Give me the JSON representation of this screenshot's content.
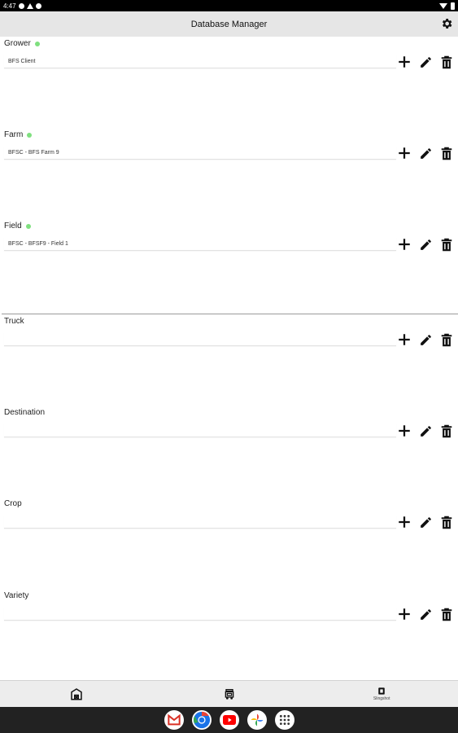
{
  "status_bar": {
    "time": "4:47"
  },
  "app_bar": {
    "title": "Database Manager"
  },
  "fields": [
    {
      "label": "Grower",
      "value": "BFS Client",
      "indicator": true
    },
    {
      "label": "Farm",
      "value": "BFSC - BFS Farm 9",
      "indicator": true
    },
    {
      "label": "Field",
      "value": "BFSC - BFSF9 - Field 1",
      "indicator": true
    },
    {
      "label": "Truck",
      "value": "",
      "indicator": false
    },
    {
      "label": "Destination",
      "value": "",
      "indicator": false
    },
    {
      "label": "Crop",
      "value": "",
      "indicator": false
    },
    {
      "label": "Variety",
      "value": "",
      "indicator": false
    }
  ],
  "bottom_nav": [
    {
      "icon": "barn-icon",
      "label": ""
    },
    {
      "icon": "truck-icon",
      "label": ""
    },
    {
      "icon": "slingshot-icon",
      "label": "Slingshot"
    }
  ],
  "dock": [
    "gmail-icon",
    "chrome-icon",
    "youtube-icon",
    "photos-icon",
    "app-drawer-icon"
  ],
  "colors": {
    "indicator": "#7fe07f",
    "app_bar": "#e6e6e6"
  }
}
